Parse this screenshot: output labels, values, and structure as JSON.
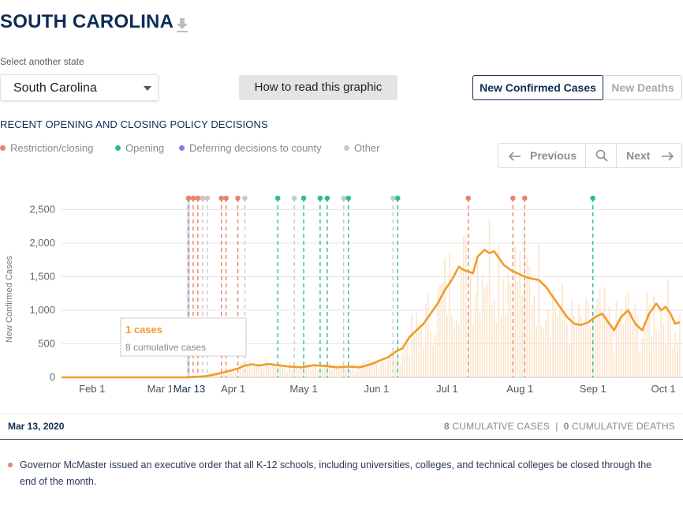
{
  "header": {
    "title": "SOUTH CAROLINA"
  },
  "state_select": {
    "label": "Select another state",
    "value": "South Carolina"
  },
  "how_to_read": {
    "label": "How to read this graphic"
  },
  "metric_toggle": {
    "cases": "New Confirmed Cases",
    "deaths": "New Deaths",
    "active": "cases"
  },
  "policy": {
    "heading": "RECENT OPENING AND CLOSING POLICY DECISIONS",
    "legend": [
      {
        "key": "restriction",
        "label": "Restriction/closing",
        "color": "#e8846a"
      },
      {
        "key": "opening",
        "label": "Opening",
        "color": "#2fbb97"
      },
      {
        "key": "deferring",
        "label": "Deferring decisions to county",
        "color": "#7d86e8"
      },
      {
        "key": "other",
        "label": "Other",
        "color": "#c9c9c9"
      }
    ]
  },
  "navigation": {
    "previous": "Previous",
    "next": "Next"
  },
  "colors": {
    "line": "#f29b2c",
    "bars": "#fbe6cc",
    "navy": "#0e2b54",
    "grid": "#e6e6e6"
  },
  "chart_data": {
    "type": "line",
    "ylabel": "New Confirmed Cases",
    "ylim": [
      0,
      2800
    ],
    "yticks": [
      0,
      500,
      1000,
      1500,
      2000,
      2500
    ],
    "ytick_labels": [
      "0",
      "500",
      "1,000",
      "1,500",
      "2,000",
      "2,500"
    ],
    "xlim": [
      "2020-01-19",
      "2020-10-08"
    ],
    "xticks": [
      {
        "date": "2020-02-01",
        "label": "Feb 1"
      },
      {
        "date": "2020-03-01",
        "label": "Mar 1"
      },
      {
        "date": "2020-04-01",
        "label": "Apr 1"
      },
      {
        "date": "2020-05-01",
        "label": "May 1"
      },
      {
        "date": "2020-06-01",
        "label": "Jun 1"
      },
      {
        "date": "2020-07-01",
        "label": "Jul 1"
      },
      {
        "date": "2020-08-01",
        "label": "Aug 1"
      },
      {
        "date": "2020-09-01",
        "label": "Sep 1"
      },
      {
        "date": "2020-10-01",
        "label": "Oct 1"
      }
    ],
    "highlight": {
      "date": "2020-03-13",
      "label": "Mar 13"
    },
    "tooltip": {
      "value_text": "1 cases",
      "sub_text": "8 cumulative cases"
    },
    "series": [
      {
        "values": [
          [
            "2020-01-19",
            0
          ],
          [
            "2020-03-05",
            0
          ],
          [
            "2020-03-13",
            1
          ],
          [
            "2020-03-20",
            15
          ],
          [
            "2020-03-25",
            50
          ],
          [
            "2020-03-30",
            90
          ],
          [
            "2020-04-03",
            130
          ],
          [
            "2020-04-06",
            175
          ],
          [
            "2020-04-09",
            195
          ],
          [
            "2020-04-12",
            175
          ],
          [
            "2020-04-16",
            200
          ],
          [
            "2020-04-20",
            180
          ],
          [
            "2020-04-25",
            160
          ],
          [
            "2020-04-30",
            150
          ],
          [
            "2020-05-05",
            180
          ],
          [
            "2020-05-10",
            170
          ],
          [
            "2020-05-15",
            150
          ],
          [
            "2020-05-20",
            160
          ],
          [
            "2020-05-25",
            150
          ],
          [
            "2020-05-30",
            200
          ],
          [
            "2020-06-03",
            260
          ],
          [
            "2020-06-06",
            300
          ],
          [
            "2020-06-09",
            380
          ],
          [
            "2020-06-12",
            430
          ],
          [
            "2020-06-15",
            600
          ],
          [
            "2020-06-18",
            700
          ],
          [
            "2020-06-21",
            800
          ],
          [
            "2020-06-24",
            950
          ],
          [
            "2020-06-27",
            1100
          ],
          [
            "2020-06-30",
            1300
          ],
          [
            "2020-07-03",
            1450
          ],
          [
            "2020-07-06",
            1650
          ],
          [
            "2020-07-08",
            1600
          ],
          [
            "2020-07-10",
            1580
          ],
          [
            "2020-07-12",
            1550
          ],
          [
            "2020-07-14",
            1800
          ],
          [
            "2020-07-17",
            1900
          ],
          [
            "2020-07-19",
            1850
          ],
          [
            "2020-07-21",
            1880
          ],
          [
            "2020-07-23",
            1780
          ],
          [
            "2020-07-25",
            1680
          ],
          [
            "2020-07-28",
            1600
          ],
          [
            "2020-07-31",
            1550
          ],
          [
            "2020-08-03",
            1500
          ],
          [
            "2020-08-06",
            1470
          ],
          [
            "2020-08-09",
            1450
          ],
          [
            "2020-08-12",
            1350
          ],
          [
            "2020-08-15",
            1200
          ],
          [
            "2020-08-18",
            1050
          ],
          [
            "2020-08-21",
            900
          ],
          [
            "2020-08-24",
            800
          ],
          [
            "2020-08-27",
            780
          ],
          [
            "2020-08-30",
            820
          ],
          [
            "2020-09-02",
            900
          ],
          [
            "2020-09-05",
            950
          ],
          [
            "2020-09-08",
            800
          ],
          [
            "2020-09-10",
            700
          ],
          [
            "2020-09-13",
            900
          ],
          [
            "2020-09-16",
            1000
          ],
          [
            "2020-09-19",
            800
          ],
          [
            "2020-09-22",
            700
          ],
          [
            "2020-09-25",
            950
          ],
          [
            "2020-09-28",
            1100
          ],
          [
            "2020-09-30",
            1000
          ],
          [
            "2020-10-02",
            1050
          ],
          [
            "2020-10-04",
            950
          ],
          [
            "2020-10-06",
            800
          ],
          [
            "2020-10-08",
            820
          ]
        ]
      }
    ],
    "policy_events": [
      {
        "date": "2020-03-13",
        "type": "deferring"
      },
      {
        "date": "2020-03-13",
        "type": "restriction"
      },
      {
        "date": "2020-03-15",
        "type": "restriction"
      },
      {
        "date": "2020-03-17",
        "type": "restriction"
      },
      {
        "date": "2020-03-19",
        "type": "other"
      },
      {
        "date": "2020-03-21",
        "type": "other"
      },
      {
        "date": "2020-03-27",
        "type": "restriction"
      },
      {
        "date": "2020-03-29",
        "type": "restriction"
      },
      {
        "date": "2020-04-03",
        "type": "restriction"
      },
      {
        "date": "2020-04-06",
        "type": "other"
      },
      {
        "date": "2020-04-20",
        "type": "opening"
      },
      {
        "date": "2020-04-27",
        "type": "other"
      },
      {
        "date": "2020-05-01",
        "type": "opening"
      },
      {
        "date": "2020-05-08",
        "type": "opening"
      },
      {
        "date": "2020-05-11",
        "type": "opening"
      },
      {
        "date": "2020-05-18",
        "type": "other"
      },
      {
        "date": "2020-05-20",
        "type": "opening"
      },
      {
        "date": "2020-06-08",
        "type": "other"
      },
      {
        "date": "2020-06-10",
        "type": "opening"
      },
      {
        "date": "2020-07-10",
        "type": "restriction"
      },
      {
        "date": "2020-07-29",
        "type": "restriction"
      },
      {
        "date": "2020-08-03",
        "type": "restriction"
      },
      {
        "date": "2020-09-01",
        "type": "opening"
      }
    ]
  },
  "date_bar": {
    "date": "Mar 13, 2020",
    "cumulative_cases_value": "8",
    "cumulative_cases_label": "CUMULATIVE CASES",
    "separator": "|",
    "cumulative_deaths_value": "0",
    "cumulative_deaths_label": "CUMULATIVE DEATHS"
  },
  "policy_note": "Governor McMaster issued an executive order that all K-12 schools, including universities, colleges, and technical colleges be closed through the end of the month."
}
